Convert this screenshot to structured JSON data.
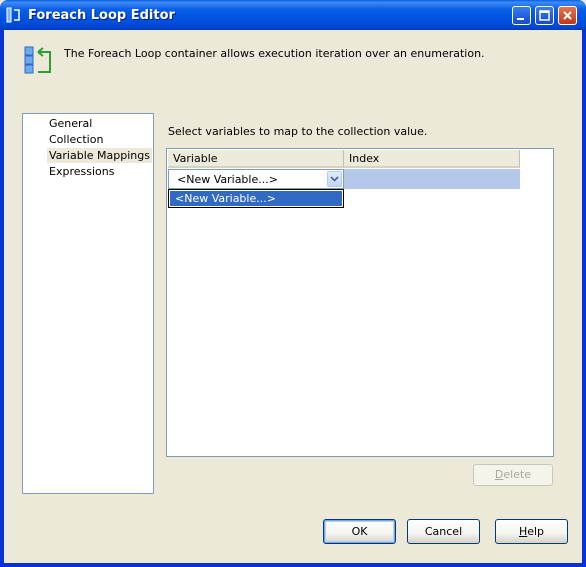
{
  "window": {
    "title": "Foreach Loop Editor"
  },
  "header": {
    "description": "The Foreach Loop container allows execution iteration over an enumeration."
  },
  "nav": {
    "items": [
      {
        "label": "General"
      },
      {
        "label": "Collection"
      },
      {
        "label": "Variable Mappings",
        "selected": true
      },
      {
        "label": "Expressions"
      }
    ]
  },
  "mappings": {
    "instruction": "Select variables to map to the collection value.",
    "columns": [
      "Variable",
      "Index"
    ],
    "row": {
      "variable": "<New Variable...>",
      "index": ""
    },
    "dropdown_options": [
      "<New Variable...>"
    ]
  },
  "buttons": {
    "delete": {
      "prefix": "",
      "accel": "D",
      "rest": "elete",
      "enabled": false
    },
    "ok": "OK",
    "cancel": "Cancel",
    "help": {
      "accel": "H",
      "rest": "elp"
    }
  },
  "colors": {
    "titlebar": "#0054e3",
    "selection": "#316ac5",
    "index_cell": "#b6c8e9"
  }
}
